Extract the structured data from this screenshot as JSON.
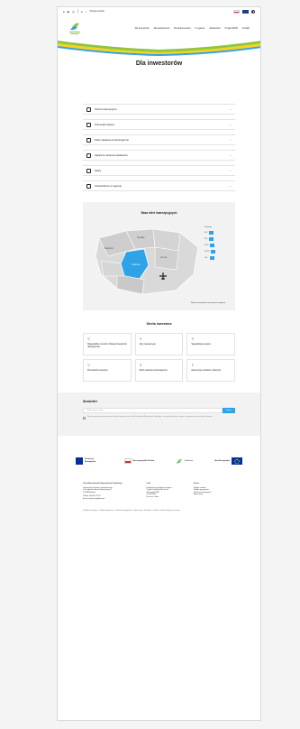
{
  "topbar": {
    "icons": [
      "facebook-icon",
      "youtube-icon",
      "instagram-icon",
      "linkedin-icon",
      "accessibility-icon"
    ],
    "search_label": "Szukaj serwisie",
    "lang_pl_color": "#cf2e2e",
    "lang_en_color": "#1e3f8a"
  },
  "header": {
    "logo_name": "leaf-logo",
    "logo_caption": "Dla inwestorów",
    "nav": [
      "Dla inwestorów",
      "Dla eksporterów",
      "Dla dokumentacji",
      "O regionie",
      "Aktualności",
      "Projekt EWSI",
      "Kontakt"
    ]
  },
  "hero": {
    "title": "Dla inwestorów",
    "colors": {
      "green": "#8dc63f",
      "yellow": "#f9d11a",
      "blue": "#2fa3e8"
    }
  },
  "accordion": [
    {
      "label": "Oferta inwestycyjna",
      "icon": "building-icon"
    },
    {
      "label": "Potencjał miejsca",
      "icon": "document-icon"
    },
    {
      "label": "Parki naukowo-technologiczne",
      "icon": "document-icon"
    },
    {
      "label": "Zaplecze naukowo-badawcze",
      "icon": "document-icon"
    },
    {
      "label": "Kadry",
      "icon": "document-icon"
    },
    {
      "label": "Infrastruktura w regionie",
      "icon": "document-icon"
    }
  ],
  "map": {
    "title": "Baza ofert inwestycyjnych",
    "legend_title": "Powiaty",
    "legend": [
      "0-2",
      "3-5",
      "6-10",
      "11-15",
      "16+"
    ],
    "labels": [
      "Gniezno",
      "Białystok",
      "Suwałki",
      "Łomża"
    ],
    "link": "Zobacz wszystkie inwestycje w regionie"
  },
  "zone": {
    "title": "Strefa inwestora",
    "cards": [
      {
        "label": "Wojewódzkie Centrum Obsługi Inwestorów i Eksporterów",
        "icon": "person-icon"
      },
      {
        "label": "Akty inwestycyjne",
        "icon": "person-icon"
      },
      {
        "label": "Specjalizacje regionu",
        "icon": "person-icon"
      },
      {
        "label": "Przewodnik inwestora",
        "icon": "person-icon"
      },
      {
        "label": "Parki naukowo-technologiczne",
        "icon": "person-icon"
      },
      {
        "label": "Zarezerwuj na Warcie i Naszymi",
        "icon": "person-icon"
      }
    ]
  },
  "newsletter": {
    "title": "Newsletter",
    "placeholder": "Podaj adres e-mail",
    "button": "Zapisz",
    "consent": "Wyrażam zgodę na przetwarzanie moich danych osobowych przez Urząd Marszałkowski Województwa Podlaskiego w celu wysyłki newslettera, zgodnie z przepisami o ochronie danych osobowych."
  },
  "funds": {
    "items": [
      "Fundusze Europejskie",
      "Rzeczpospolita Polska",
      "Podlaskie",
      "Unia Europejska"
    ]
  },
  "footer": {
    "col1": [
      "Urząd Marszałkowski Województwa Podlaskiego",
      "Departament Rozwoju Gospodarczego",
      "ul. Kardynała Stefana Wyszyńskiego 1",
      "15-888 Białystok",
      "Telefon: (85) 66 54 270",
      "Email: oie@wrotapodlasia.pl"
    ],
    "col2_title": "Linki",
    "col2": [
      "Inteligentne specjalizacje regionu",
      "Projekt „Podlaskie Biz Invest”",
      "Wspieranie MŚP",
      "Portal EWSI",
      "Na rzecz Ciebie"
    ],
    "col3_title": "Serwis",
    "col3": [
      "Polityka cookies",
      "Polityka prywatności",
      "Deklaracja dostępności",
      "Mapa strony"
    ],
    "bottom": "Podlaskie inwestycje · Polityka prywatności · Deklaracja dostępności · Mapa strony · Newsletter · Kontakt z działem obsługi inwestorów"
  }
}
